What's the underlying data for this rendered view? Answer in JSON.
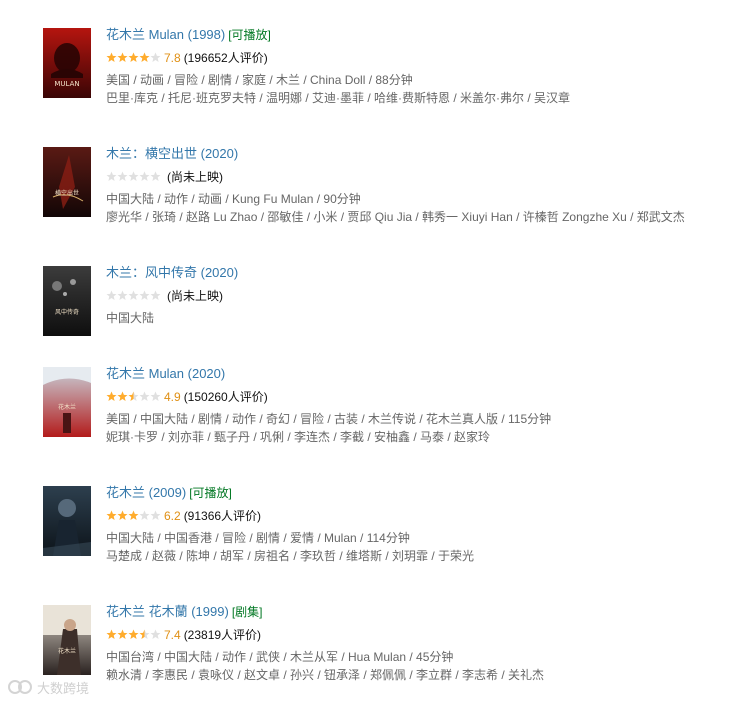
{
  "results": [
    {
      "title": "花木兰 Mulan (1998)",
      "badge": "[可播放]",
      "stars": 4.0,
      "score": "7.8",
      "rating_text": "(196652人评价)",
      "info": "美国 / 动画 / 冒险 / 剧情 / 家庭 / 木兰 / China Doll / 88分钟",
      "cast": "巴里·库克 / 托尼·班克罗夫特 / 温明娜 / 艾迪·墨菲 / 哈维·费斯特恩 / 米盖尔·弗尔 / 吴汉章",
      "poster_text": "MULAN",
      "poster_colors": [
        "#b5150f",
        "#3a0505"
      ]
    },
    {
      "title": "木兰：横空出世 (2020)",
      "badge": "",
      "stars": 0,
      "score": "",
      "rating_text": "(尚未上映)",
      "info": "中国大陆 / 动作 / 动画 / Kung Fu Mulan / 90分钟",
      "cast": "廖光华 / 张琦 / 赵路 Lu Zhao / 邵敏佳 / 小米 / 贾邱 Qiu Jia / 韩秀一 Xiuyi Han / 许榛哲 Zongzhe Xu / 郑武文杰",
      "poster_text": "横空出世",
      "poster_colors": [
        "#5a1a14",
        "#120606"
      ]
    },
    {
      "title": "木兰：风中传奇 (2020)",
      "badge": "",
      "stars": 0,
      "score": "",
      "rating_text": "(尚未上映)",
      "info": "中国大陆",
      "cast": "",
      "poster_text": "风中传奇",
      "poster_colors": [
        "#3c3c3c",
        "#0e0e0e"
      ]
    },
    {
      "title": "花木兰 Mulan (2020)",
      "badge": "",
      "stars": 2.5,
      "score": "4.9",
      "rating_text": "(150260人评价)",
      "info": "美国 / 中国大陆 / 剧情 / 动作 / 奇幻 / 冒险 / 古装 / 木兰传说 / 花木兰真人版 / 115分钟",
      "cast": "妮琪·卡罗 / 刘亦菲 / 甄子丹 / 巩俐 / 李连杰 / 李截 / 安柚鑫 / 马泰 / 赵家玲",
      "poster_text": "花木兰",
      "poster_colors": [
        "#c9d3dc",
        "#b31b1b"
      ]
    },
    {
      "title": "花木兰 (2009)",
      "badge": "[可播放]",
      "stars": 3.0,
      "score": "6.2",
      "rating_text": "(91366人评价)",
      "info": "中国大陆 / 中国香港 / 冒险 / 剧情 / 爱情 / Mulan / 114分钟",
      "cast": "马楚成 / 赵薇 / 陈坤 / 胡军 / 房祖名 / 李玖哲 / 维塔斯 / 刘玥霏 / 于荣光",
      "poster_text": "",
      "poster_colors": [
        "#2d3f4e",
        "#0c1319"
      ]
    },
    {
      "title": "花木兰 花木蘭 (1999)",
      "badge": "[剧集]",
      "stars": 3.5,
      "score": "7.4",
      "rating_text": "(23819人评价)",
      "info": "中国台湾 / 中国大陆 / 动作 / 武侠 / 木兰从军 / Hua Mulan / 45分钟",
      "cast": "赖水清 / 李惠民 / 袁咏仪 / 赵文卓 / 孙兴 / 钮承泽 / 郑佩佩 / 李立群 / 李志希 / 关礼杰",
      "poster_text": "花木兰",
      "poster_colors": [
        "#d8d1c6",
        "#2a2220"
      ]
    }
  ],
  "watermark": "大数跨境",
  "colors": {
    "link": "#3377aa",
    "badge": "#007722",
    "score": "#e09015",
    "star_on": "#ffac2d",
    "star_off": "#e0e0e0"
  }
}
